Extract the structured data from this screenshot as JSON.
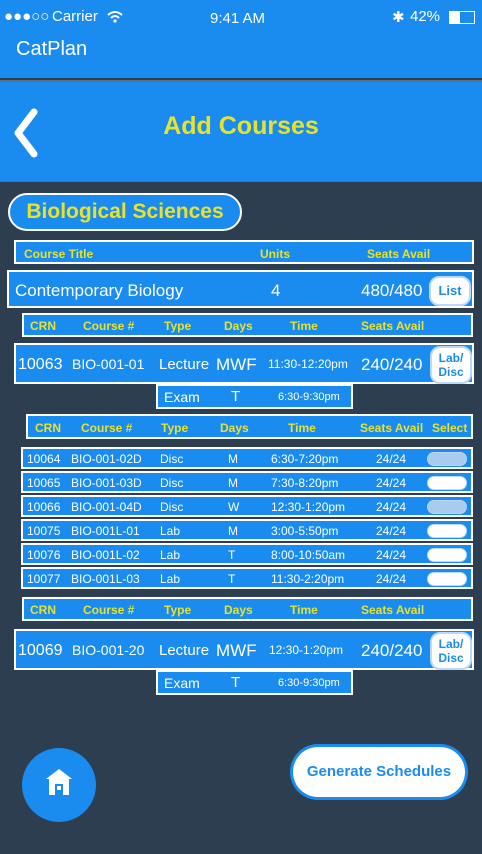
{
  "status": {
    "carrier": "Carrier",
    "time": "9:41 AM",
    "battery": "42%"
  },
  "app": {
    "name": "CatPlan"
  },
  "header": {
    "title": "Add Courses"
  },
  "department": "Biological Sciences",
  "course_header": {
    "title": "Course Title",
    "units": "Units",
    "seats": "Seats Avail"
  },
  "course": {
    "title": "Contemporary Biology",
    "units": "4",
    "seats": "480/480",
    "button": "List"
  },
  "section_header": {
    "crn": "CRN",
    "course": "Course #",
    "type": "Type",
    "days": "Days",
    "time": "Time",
    "seats": "Seats Avail"
  },
  "lab_header": {
    "crn": "CRN",
    "course": "Course #",
    "type": "Type",
    "days": "Days",
    "time": "Time",
    "seats": "Seats Avail",
    "select": "Select"
  },
  "section1": {
    "crn": "10063",
    "course": "BIO-001-01",
    "type": "Lecture",
    "days": "MWF",
    "time": "11:30-12:20pm",
    "seats": "240/240",
    "button": "Lab/ Disc"
  },
  "exam1": {
    "type": "Exam",
    "days": "T",
    "time": "6:30-9:30pm"
  },
  "labs": [
    {
      "crn": "10064",
      "course": "BIO-001-02D",
      "type": "Disc",
      "days": "M",
      "time": "6:30-7:20pm",
      "seats": "24/24"
    },
    {
      "crn": "10065",
      "course": "BIO-001-03D",
      "type": "Disc",
      "days": "M",
      "time": "7:30-8:20pm",
      "seats": "24/24"
    },
    {
      "crn": "10066",
      "course": "BIO-001-04D",
      "type": "Disc",
      "days": "W",
      "time": "12:30-1:20pm",
      "seats": "24/24"
    },
    {
      "crn": "10075",
      "course": "BIO-001L-01",
      "type": "Lab",
      "days": "M",
      "time": "3:00-5:50pm",
      "seats": "24/24"
    },
    {
      "crn": "10076",
      "course": "BIO-001L-02",
      "type": "Lab",
      "days": "T",
      "time": "8:00-10:50am",
      "seats": "24/24"
    },
    {
      "crn": "10077",
      "course": "BIO-001L-03",
      "type": "Lab",
      "days": "T",
      "time": "11:30-2:20pm",
      "seats": "24/24"
    }
  ],
  "section2": {
    "crn": "10069",
    "course": "BIO-001-20",
    "type": "Lecture",
    "days": "MWF",
    "time": "12:30-1:20pm",
    "seats": "240/240",
    "button": "Lab/ Disc"
  },
  "exam2": {
    "type": "Exam",
    "days": "T",
    "time": "6:30-9:30pm"
  },
  "footer": {
    "generate": "Generate Schedules"
  },
  "colors": {
    "primary": "#1a8cf0",
    "background": "#2c3e50",
    "accent": "#e8e22a"
  }
}
